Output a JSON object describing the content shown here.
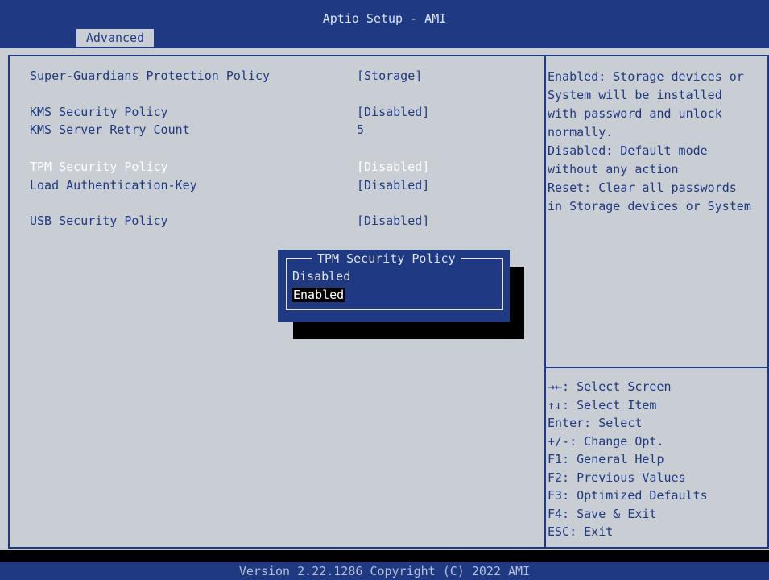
{
  "header": {
    "title": "Aptio Setup - AMI",
    "active_tab": "Advanced"
  },
  "settings": [
    {
      "label": "Super-Guardians Protection Policy",
      "value": "[Storage]"
    },
    {
      "label": "KMS Security Policy",
      "value": "[Disabled]"
    },
    {
      "label": "KMS Server Retry Count",
      "value": "5"
    },
    {
      "label": "TPM Security Policy",
      "value": "[Disabled]"
    },
    {
      "label": "Load Authentication-Key",
      "value": "[Disabled]"
    },
    {
      "label": "USB Security Policy",
      "value": "[Disabled]"
    }
  ],
  "help_text": "Enabled: Storage devices or\nSystem will be installed\nwith password and unlock\nnormally.\nDisabled: Default mode\nwithout any action\nReset: Clear all passwords\nin Storage devices or System",
  "key_help": "→←: Select Screen\n↑↓: Select Item\nEnter: Select\n+/-: Change Opt.\nF1: General Help\nF2: Previous Values\nF3: Optimized Defaults\nF4: Save & Exit\nESC: Exit",
  "popup": {
    "title": "TPM Security Policy",
    "options": [
      "Disabled",
      "Enabled"
    ],
    "selected": "Enabled"
  },
  "footer": "Version 2.22.1286 Copyright (C) 2022 AMI",
  "colors": {
    "blue": "#1f3a82",
    "grey": "#c9cdd4",
    "white": "#ffffff"
  }
}
